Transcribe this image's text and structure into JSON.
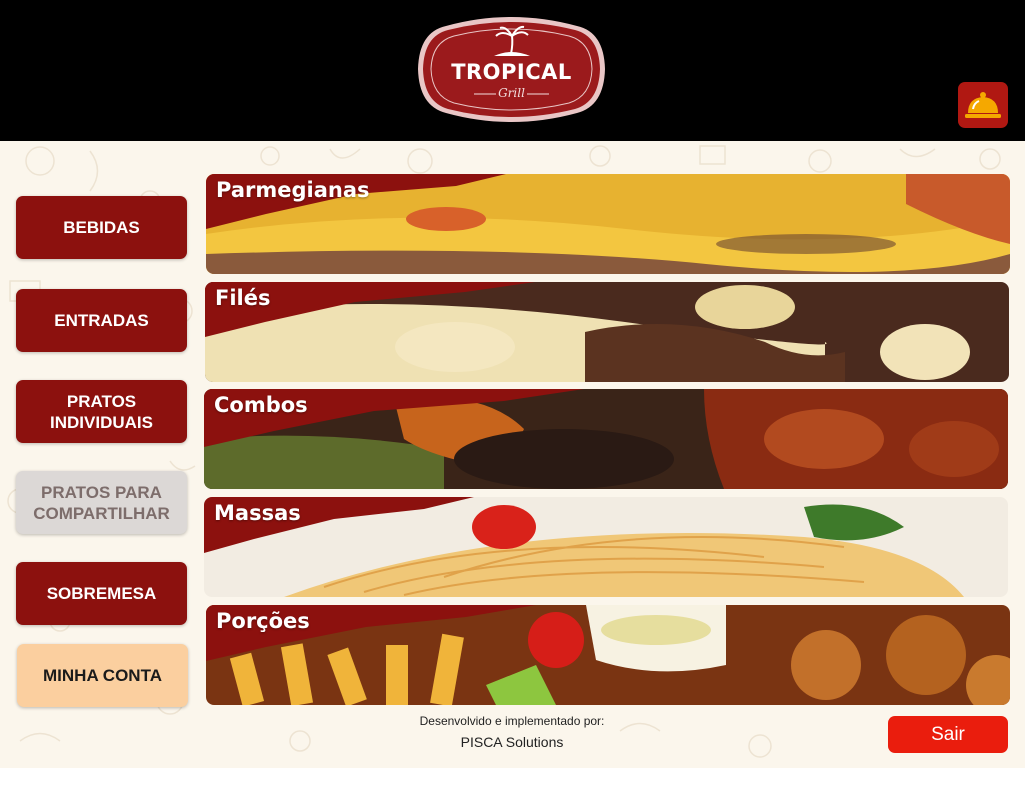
{
  "brand": {
    "name": "TROPICAL",
    "subtitle": "Grill",
    "logo_color": "#9b1a1c",
    "logo_border": "#e9c6c6",
    "icon": "palm-tree-icon"
  },
  "header": {
    "service_button_icon": "service-bell-icon"
  },
  "sidebar": {
    "items": [
      {
        "label": "BEBIDAS",
        "state": "active"
      },
      {
        "label": "ENTRADAS",
        "state": "active"
      },
      {
        "label": "PRATOS\nINDIVIDUAIS",
        "state": "active"
      },
      {
        "label": "PRATOS PARA\nCOMPARTILHAR",
        "state": "inactive"
      },
      {
        "label": "SOBREMESA",
        "state": "active"
      },
      {
        "label": "MINHA CONTA",
        "state": "account"
      }
    ]
  },
  "categories": [
    {
      "title": "Parmegianas"
    },
    {
      "title": "Filés"
    },
    {
      "title": "Combos"
    },
    {
      "title": "Massas"
    },
    {
      "title": "Porções"
    }
  ],
  "footer": {
    "credit_label": "Desenvolvido e implementado por:",
    "credit_company": "PISCA Solutions",
    "exit_label": "Sair"
  },
  "colors": {
    "header_bg": "#000000",
    "accent_red": "#8c110e",
    "exit_red": "#ea1d0d",
    "bell_yellow": "#f5a800",
    "account_peach": "#fbcf9f",
    "page_bg": "#fbf6ec"
  }
}
